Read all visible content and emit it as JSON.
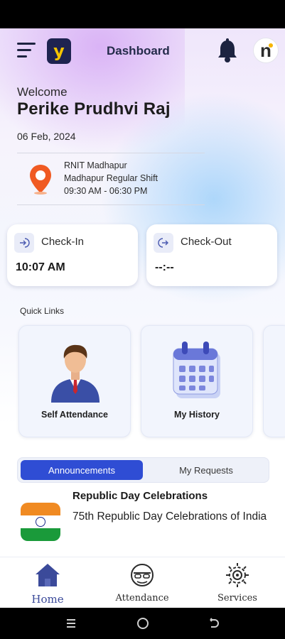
{
  "header": {
    "title": "Dashboard",
    "logo_letter": "y",
    "avatar_letter": "n"
  },
  "welcome": {
    "greeting": "Welcome",
    "name": "Perike Prudhvi Raj",
    "date": "06 Feb, 2024"
  },
  "location": {
    "site": "RNIT Madhapur",
    "shift": "Madhapur Regular Shift",
    "timing": "09:30 AM - 06:30 PM"
  },
  "check_in": {
    "label": "Check-In",
    "value": "10:07 AM"
  },
  "check_out": {
    "label": "Check-Out",
    "value": "--:--"
  },
  "quick_links": {
    "title": "Quick Links",
    "items": [
      {
        "label": "Self Attendance",
        "icon": "person-icon"
      },
      {
        "label": "My History",
        "icon": "calendar-icon"
      }
    ]
  },
  "tabs": {
    "active": "Announcements",
    "inactive": "My Requests"
  },
  "announcement": {
    "title": "Republic Day Celebrations",
    "body": "75th Republic Day Celebrations of India"
  },
  "bottom_nav": {
    "items": [
      {
        "label": "Home",
        "icon": "home-icon"
      },
      {
        "label": "Attendance",
        "icon": "attendance-icon"
      },
      {
        "label": "Services",
        "icon": "services-icon"
      }
    ]
  },
  "colors": {
    "accent": "#2f4dd4",
    "nav_active": "#3b4a9a",
    "pin": "#f05a22"
  }
}
